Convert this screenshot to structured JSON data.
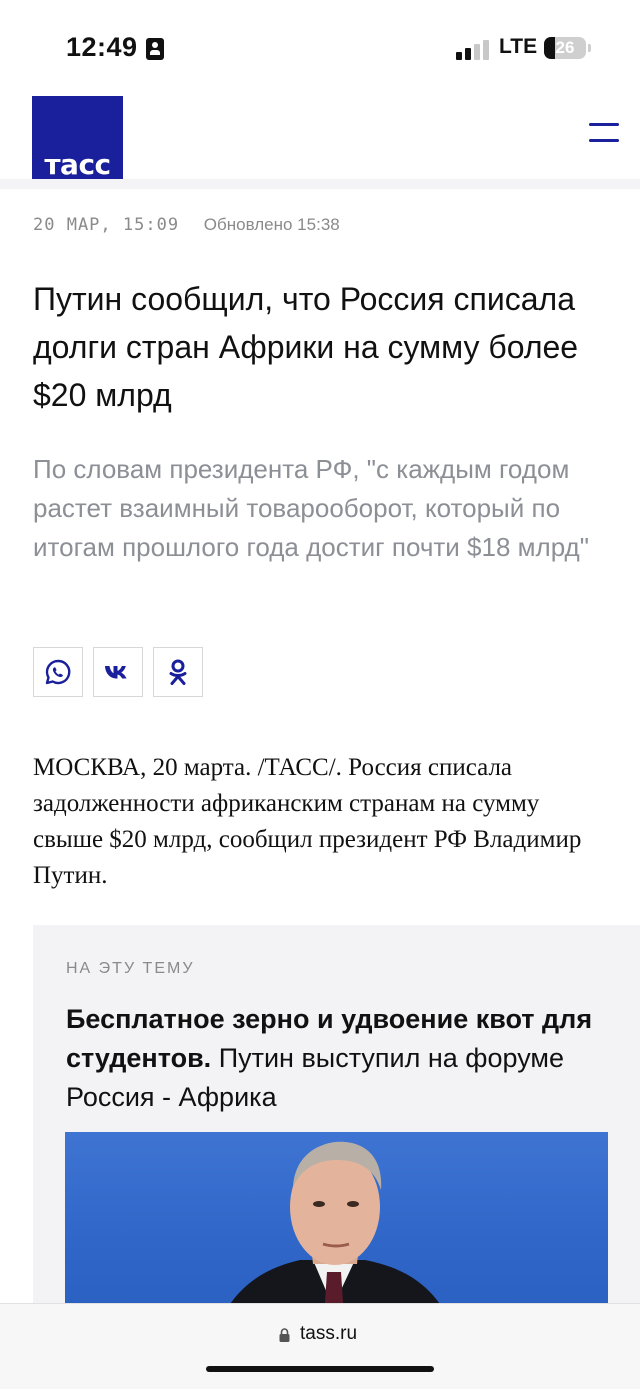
{
  "status_bar": {
    "time": "12:49",
    "network": "LTE",
    "battery": "26",
    "battery_level": 0.26,
    "icons": [
      "id-card-icon",
      "signal-icon",
      "battery-icon"
    ]
  },
  "header": {
    "logo_text": "тасс",
    "brand_color": "#1a1f9b",
    "icons": [
      "menu-icon"
    ]
  },
  "article": {
    "date": "20 МАР, 15:09",
    "updated": "Обновлено 15:38",
    "headline": "Путин сообщил, что Россия списала долги стран Африки на сумму более $20 млрд",
    "lead": "По словам президента РФ, \"с каждым годом растет взаимный товарооборот, который по итогам прошлого года достиг почти $18 млрд\"",
    "share_icons": [
      "whatsapp-icon",
      "vk-icon",
      "odnoklassniki-icon"
    ],
    "body": "МОСКВА, 20 марта. /ТАСС/. Россия списала задолженности африканским странам на сумму свыше $20 млрд, сообщил президент РФ Владимир Путин."
  },
  "related": {
    "label": "НА ЭТУ ТЕМУ",
    "title_bold": "Бесплатное зерно и удвоение квот для студентов.",
    "title_rest": " Путин выступил на форуме Россия - Африка"
  },
  "browser": {
    "url": "tass.ru",
    "icons": [
      "lock-icon"
    ]
  }
}
